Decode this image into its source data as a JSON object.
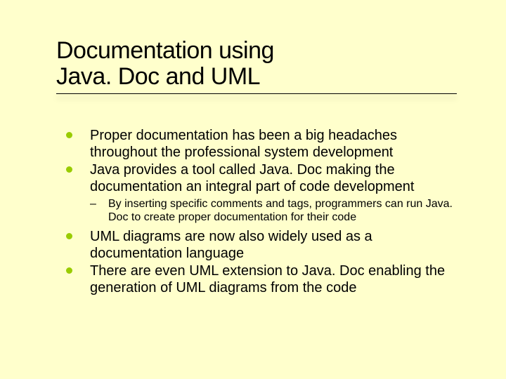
{
  "title": {
    "line1": "Documentation using",
    "line2": "Java. Doc and UML"
  },
  "bullets": [
    {
      "text": "Proper documentation has been a big headaches throughout the professional system development"
    },
    {
      "text": "Java provides a tool called Java. Doc making the documentation an integral part of code development",
      "sub": [
        "By inserting specific comments and tags, programmers can run Java. Doc to create proper documentation for their code"
      ]
    },
    {
      "text": "UML diagrams are now also widely used as a documentation language"
    },
    {
      "text": "There are even UML extension to Java. Doc enabling the generation of UML diagrams from the code"
    }
  ]
}
